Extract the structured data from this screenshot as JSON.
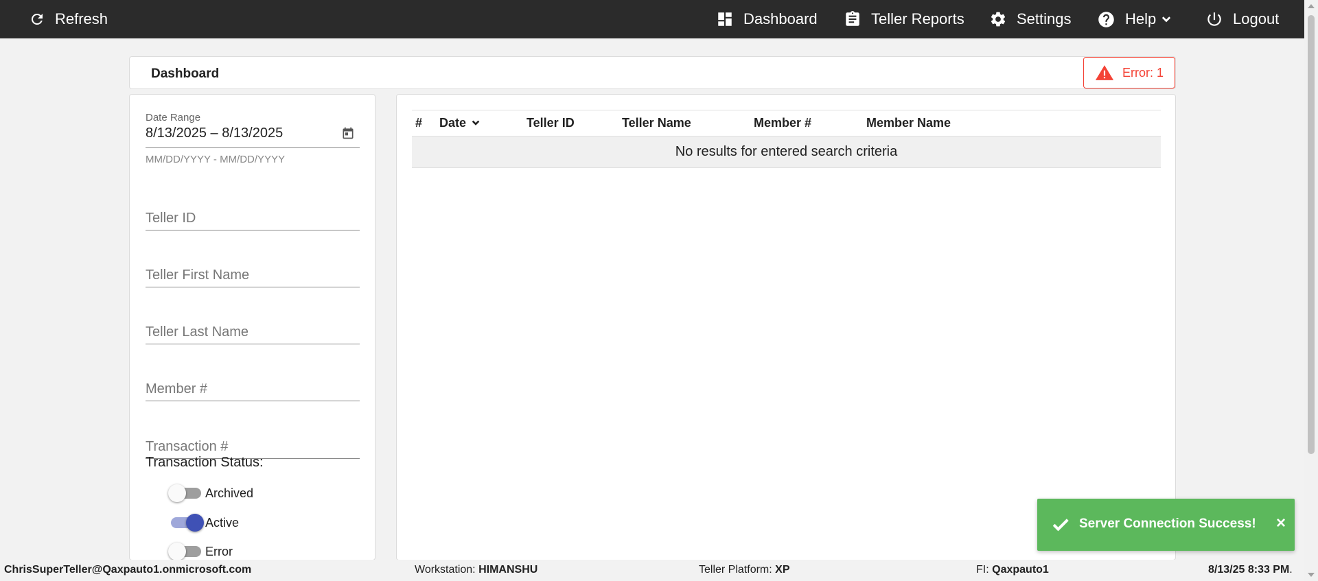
{
  "nav": {
    "refresh": "Refresh",
    "dashboard": "Dashboard",
    "teller_reports": "Teller Reports",
    "settings": "Settings",
    "help": "Help",
    "logout": "Logout"
  },
  "header": {
    "title": "Dashboard",
    "error_badge": "Error: 1"
  },
  "filters": {
    "date_range_label": "Date Range",
    "date_range_value": "8/13/2025 – 8/13/2025",
    "date_range_hint": "MM/DD/YYYY - MM/DD/YYYY",
    "teller_id_placeholder": "Teller ID",
    "teller_first_name_placeholder": "Teller First Name",
    "teller_last_name_placeholder": "Teller Last Name",
    "member_number_placeholder": "Member #",
    "transaction_number_placeholder": "Transaction #",
    "status_label": "Transaction Status:",
    "statuses": [
      {
        "label": "Archived",
        "on": false
      },
      {
        "label": "Active",
        "on": true
      },
      {
        "label": "Error",
        "on": false
      }
    ]
  },
  "table": {
    "columns": [
      "#",
      "Date",
      "Teller ID",
      "Teller Name",
      "Member #",
      "Member Name"
    ],
    "empty_message": "No results for entered search criteria"
  },
  "toast": {
    "message": "Server Connection Success!",
    "close": "×"
  },
  "statusbar": {
    "user": "ChrisSuperTeller@Qaxpauto1.onmicrosoft.com",
    "workstation_label": "Workstation:",
    "workstation": "HIMANSHU",
    "platform_label": "Teller Platform:",
    "platform": "XP",
    "fi_label": "FI:",
    "fi": "Qaxpauto1",
    "datetime": "8/13/25 8:33 PM",
    "datetime_suffix": "."
  },
  "colors": {
    "topbar": "#2b2b2b",
    "error": "#f44336",
    "toast": "#5cb85c",
    "toggle_on": "#3f51b5"
  }
}
